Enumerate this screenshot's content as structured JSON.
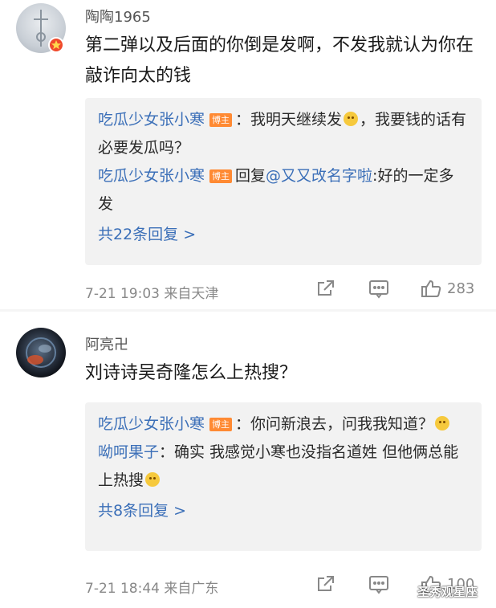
{
  "comments": [
    {
      "username": "陶陶1965",
      "text": "第二弹以及后面的你倒是发啊，不发我就认为你在敲诈向太的钱",
      "replies": [
        {
          "name": "吃瓜少女张小寒",
          "tag": "博主",
          "text_before": "：我明天继续发",
          "emoji": "emoji",
          "text_after": "，我要钱的话有必要发瓜吗？"
        },
        {
          "name": "吃瓜少女张小寒",
          "tag": "博主",
          "prefix": "回复",
          "mention": "@又又改名字啦",
          "text": ":好的一定多发"
        }
      ],
      "more": "共22条回复 >",
      "time": "7-21 19:03",
      "location": "来自天津",
      "likes": "283"
    },
    {
      "username": "阿亮卍",
      "text": "刘诗诗吴奇隆怎么上热搜？",
      "replies": [
        {
          "name": "吃瓜少女张小寒",
          "tag": "博主",
          "text": "：你问新浪去，问我我知道？"
        },
        {
          "name": "呦呵果子",
          "text": "：确实 我感觉小寒也没指名道姓 但他俩总能上热搜"
        }
      ],
      "more": "共8条回复 >",
      "time": "7-21 18:44",
      "location": "来自广东",
      "likes": "100"
    }
  ],
  "watermark": "圣秀观星座",
  "icons": {
    "share": "share-icon",
    "comment": "comment-icon",
    "like": "thumbs-up-icon",
    "avatar_badge": "flag-badge-icon"
  },
  "colors": {
    "link": "#3b6fb8",
    "tag": "#ff8a33",
    "badge": "#f04a2c",
    "reply_bg": "#f2f2f2"
  }
}
